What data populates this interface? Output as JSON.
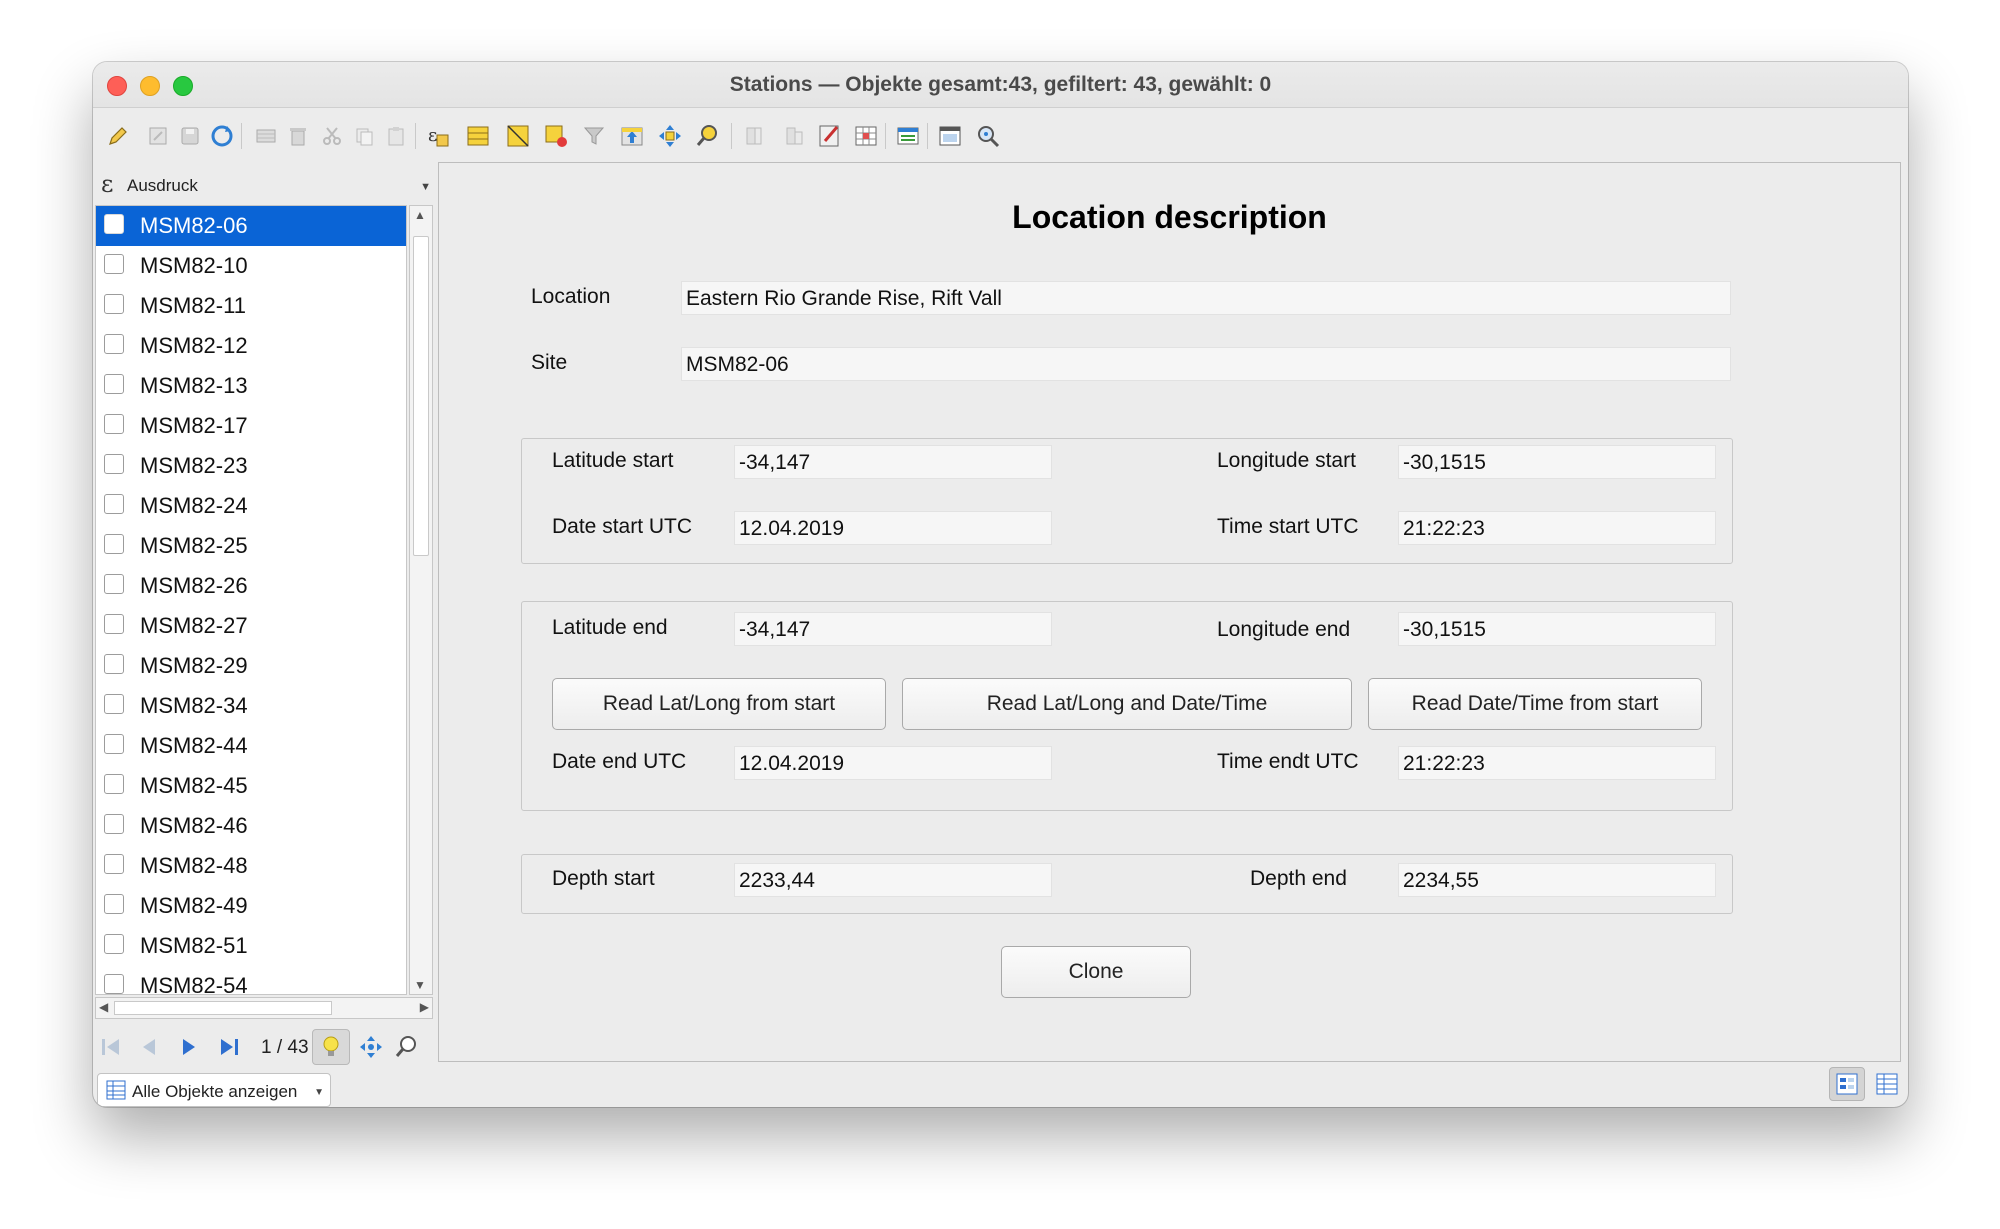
{
  "window": {
    "title": "Stations — Objekte gesamt:43, gefiltert: 43, gewählt: 0"
  },
  "toolbar": {
    "icons": [
      "pencil-icon",
      "edit-multiple-icon",
      "save-icon",
      "reload-icon",
      "add-feature-icon",
      "delete-feature-icon",
      "cut-icon",
      "copy-icon",
      "paste-icon",
      "select-by-expression-icon",
      "select-all-icon",
      "invert-selection-icon",
      "deselect-icon",
      "filter-icon",
      "move-selection-to-top-icon",
      "pan-to-selection-icon",
      "zoom-to-selection-icon",
      "new-field-icon",
      "delete-field-icon",
      "field-calculator-icon",
      "conditional-formatting-icon",
      "dock-attribute-table-icon",
      "actions-icon",
      "identify-icon"
    ]
  },
  "sidebar": {
    "expression_label": "Ausdruck",
    "items": [
      {
        "label": "MSM82-06",
        "selected": true
      },
      {
        "label": "MSM82-10"
      },
      {
        "label": "MSM82-11"
      },
      {
        "label": "MSM82-12"
      },
      {
        "label": "MSM82-13"
      },
      {
        "label": "MSM82-17"
      },
      {
        "label": "MSM82-23"
      },
      {
        "label": "MSM82-24"
      },
      {
        "label": "MSM82-25"
      },
      {
        "label": "MSM82-26"
      },
      {
        "label": "MSM82-27"
      },
      {
        "label": "MSM82-29"
      },
      {
        "label": "MSM82-34"
      },
      {
        "label": "MSM82-44"
      },
      {
        "label": "MSM82-45"
      },
      {
        "label": "MSM82-46"
      },
      {
        "label": "MSM82-48"
      },
      {
        "label": "MSM82-49"
      },
      {
        "label": "MSM82-51"
      },
      {
        "label": "MSM82-54"
      }
    ],
    "nav_count": "1 / 43",
    "show_all_label": "Alle Objekte anzeigen"
  },
  "form": {
    "title": "Location description",
    "location": {
      "label": "Location",
      "value": "Eastern Rio Grande Rise, Rift Vall"
    },
    "site": {
      "label": "Site",
      "value": "MSM82-06"
    },
    "start": {
      "lat_label": "Latitude start",
      "lat_value": "-34,147",
      "lon_label": "Longitude start",
      "lon_value": "-30,1515",
      "date_label": "Date start UTC",
      "date_value": "12.04.2019",
      "time_label": "Time start UTC",
      "time_value": "21:22:23"
    },
    "end": {
      "lat_label": "Latitude end",
      "lat_value": "-34,147",
      "lon_label": "Longitude end",
      "lon_value": "-30,1515",
      "btn_latlong": "Read Lat/Long from start",
      "btn_latlong_datetime": "Read Lat/Long and Date/Time",
      "btn_datetime": "Read Date/Time from start",
      "date_label": "Date end UTC",
      "date_value": "12.04.2019",
      "time_label": "Time endt UTC",
      "time_value": "21:22:23"
    },
    "depth": {
      "start_label": "Depth start",
      "start_value": "2233,44",
      "end_label": "Depth end",
      "end_value": "2234,55"
    },
    "clone_label": "Clone"
  },
  "colors": {
    "selection": "#0a64d6",
    "close": "#fe5f57",
    "minimize": "#febc2e",
    "zoom": "#28c840"
  }
}
